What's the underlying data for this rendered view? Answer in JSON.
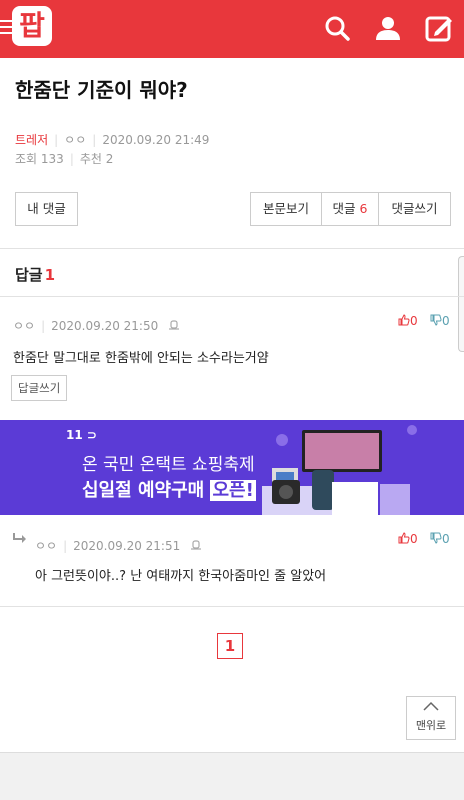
{
  "header": {
    "logo_text": "팝",
    "icons": [
      "menu-icon",
      "search-icon",
      "user-icon",
      "write-icon"
    ],
    "bg_color": "#e8373c"
  },
  "post": {
    "title": "한줌단 기준이 뭐야?",
    "author": "트레저",
    "nickname": "ㅇㅇ",
    "datetime": "2020.09.20 21:49",
    "views_label": "조회 133",
    "recommend_label": "추천 2"
  },
  "buttons": {
    "my_comments": "내 댓글",
    "view_body": "본문보기",
    "comments_label": "댓글",
    "comments_count": "6",
    "write_comment": "댓글쓰기"
  },
  "replies_section": {
    "label": "답글",
    "count": "1"
  },
  "comments": [
    {
      "nickname": "ㅇㅇ",
      "datetime": "2020.09.20 21:50",
      "text": "한줌단 말그대로 한줌밖에 안되는 소수라는거얌",
      "up": "0",
      "down": "0",
      "reply_button": "답글쓰기"
    },
    {
      "nickname": "ㅇㅇ",
      "datetime": "2020.09.20 21:51",
      "text": "아 그런뜻이야..? 난 여태까지 한국아줌마인 줄 알았어",
      "up": "0",
      "down": "0"
    }
  ],
  "banner": {
    "brand": "11",
    "line1": "온 국민 온택트 쇼핑축제",
    "line2_prefix": "십일절 예약구매 ",
    "line2_highlight": "오픈!",
    "bg_color": "#5b3bd6"
  },
  "pagination": {
    "current": "1"
  },
  "to_top": {
    "label": "맨위로"
  }
}
